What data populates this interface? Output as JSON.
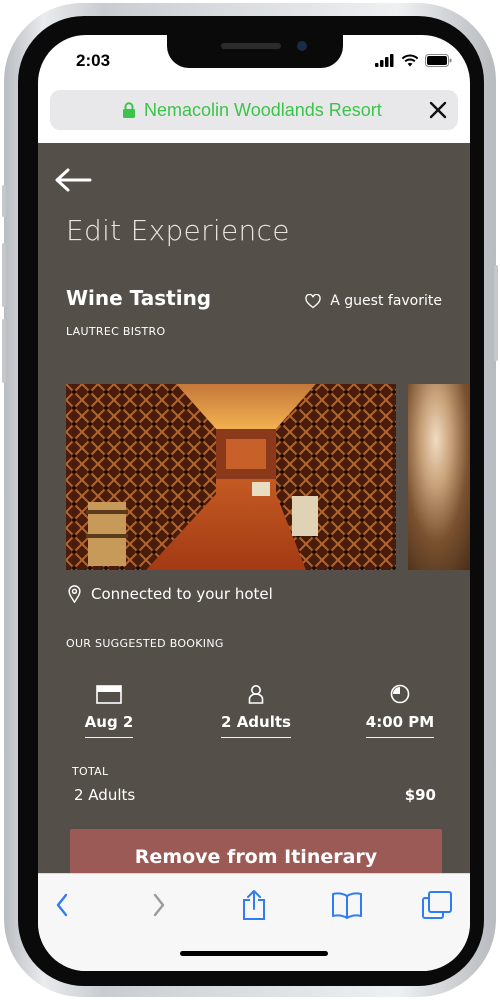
{
  "status_bar": {
    "time": "2:03"
  },
  "browser": {
    "site_name": "Nemacolin Woodlands Resort"
  },
  "experience": {
    "page_title": "Edit Experience",
    "name": "Wine Tasting",
    "favorite_label": "A guest favorite",
    "venue": "LAUTREC BISTRO",
    "location_note": "Connected to your hotel",
    "suggested_label": "OUR SUGGESTED BOOKING",
    "booking": {
      "date": "Aug 2",
      "guests": "2 Adults",
      "time": "4:00 PM"
    },
    "total_label": "TOTAL",
    "total_desc": "2 Adults",
    "total_price": "$90",
    "remove_button": "Remove from Itinerary"
  },
  "colors": {
    "content_bg": "#544f48",
    "button_bg": "#9b5a56",
    "url_green": "#3cc34a",
    "toolbar_blue": "#2f7cf6"
  },
  "icons": [
    "lock-icon",
    "close-icon",
    "back-arrow-icon",
    "heart-icon",
    "location-pin-icon",
    "calendar-icon",
    "person-icon",
    "clock-icon",
    "nav-back-icon",
    "nav-forward-icon",
    "share-icon",
    "bookmarks-icon",
    "tabs-icon"
  ]
}
